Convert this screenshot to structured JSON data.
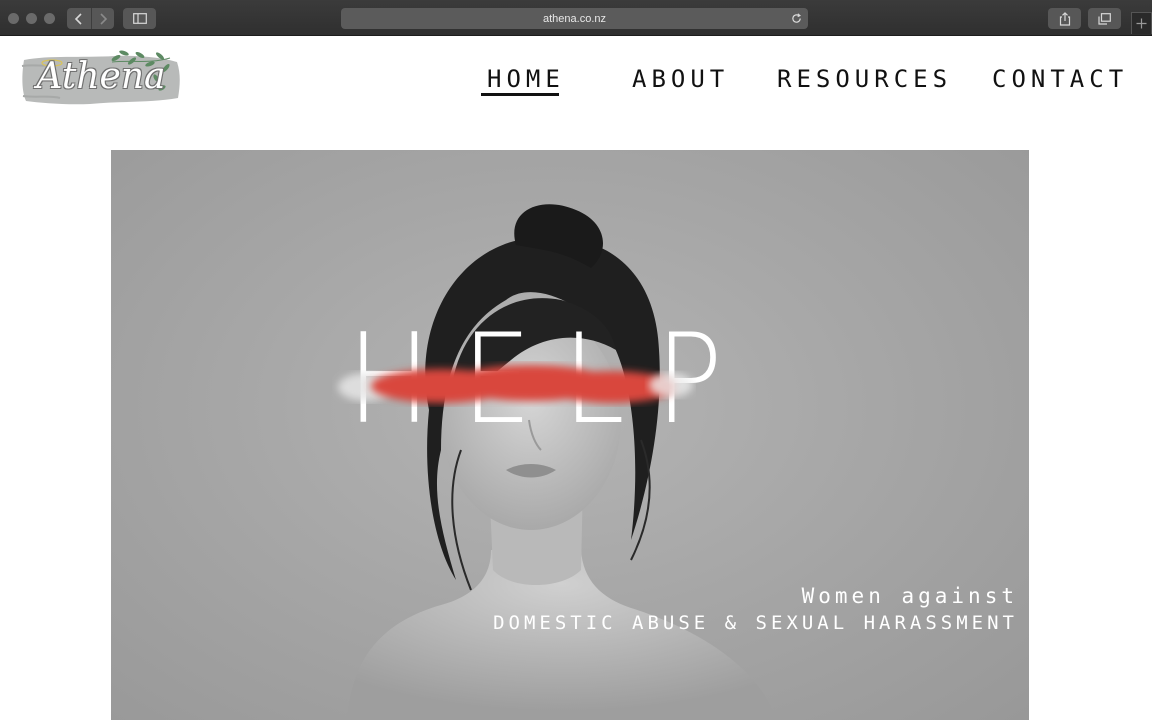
{
  "browser": {
    "url": "athena.co.nz",
    "icons": {
      "back": "chevron-left-icon",
      "forward": "chevron-right-icon",
      "sidebar": "sidebar-icon",
      "reload": "reload-icon",
      "share": "share-icon",
      "tabs": "tabs-overview-icon",
      "new_tab": "plus-icon"
    }
  },
  "site": {
    "logo_text": "Athena",
    "nav": {
      "home": "HOME",
      "about": "ABOUT",
      "resources": "RESOURCES",
      "contact": "CONTACT",
      "active": "home"
    }
  },
  "hero": {
    "headline": "HELP",
    "tagline_line1": "Women against",
    "tagline_line2": "DOMESTIC ABUSE & SEXUAL HARASSMENT",
    "smear_color": "#d9473c"
  }
}
